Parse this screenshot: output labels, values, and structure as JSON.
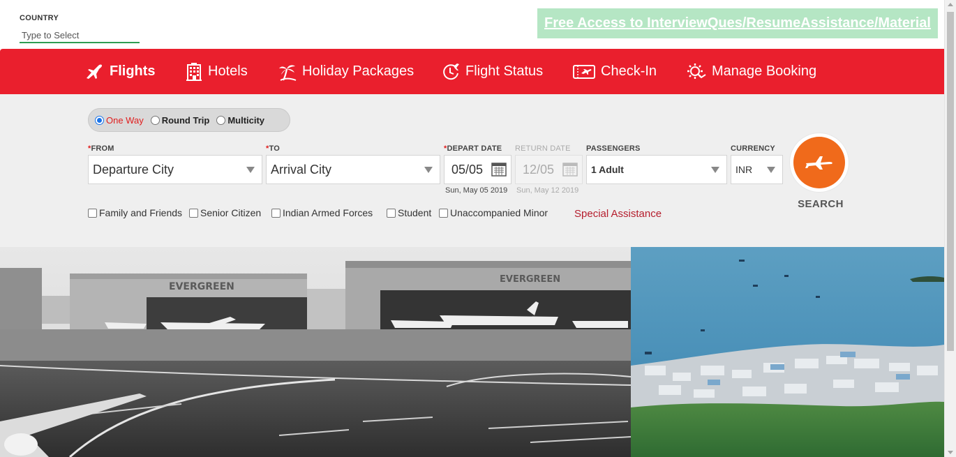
{
  "country": {
    "label": "COUNTRY",
    "placeholder": "Type to Select"
  },
  "promo": {
    "text": "Free Access to InterviewQues/ResumeAssistance/Material"
  },
  "nav": {
    "items": [
      {
        "label": "Flights",
        "icon": "airplane-icon",
        "active": true
      },
      {
        "label": "Hotels",
        "icon": "hotel-building-icon"
      },
      {
        "label": "Holiday Packages",
        "icon": "palm-tree-icon"
      },
      {
        "label": "Flight Status",
        "icon": "clock-plane-icon"
      },
      {
        "label": "Check-In",
        "icon": "ticket-icon"
      },
      {
        "label": "Manage Booking",
        "icon": "gear-booking-icon"
      }
    ]
  },
  "trip_type": {
    "options": [
      "One Way",
      "Round Trip",
      "Multicity"
    ],
    "selected": "One Way"
  },
  "form": {
    "from": {
      "label": "FROM",
      "value": "Departure City"
    },
    "to": {
      "label": "TO",
      "value": "Arrival City"
    },
    "depart": {
      "label": "DEPART DATE",
      "value": "05/05",
      "full": "Sun, May 05 2019"
    },
    "return": {
      "label": "RETURN DATE",
      "value": "12/05",
      "full": "Sun, May 12 2019"
    },
    "passengers": {
      "label": "PASSENGERS",
      "value": "1 Adult"
    },
    "currency": {
      "label": "CURRENCY",
      "value": "INR"
    }
  },
  "search": {
    "label": "SEARCH"
  },
  "concessions": [
    "Family and Friends",
    "Senior Citizen",
    "Indian Armed Forces",
    "Student",
    "Unaccompanied Minor"
  ],
  "special_assistance": "Special Assistance",
  "hero": {
    "left_sign": "EVERGREEN",
    "right_sign": "EVERGREEN"
  },
  "colors": {
    "nav": "#ea1f2d",
    "search": "#f06a1b",
    "promo": "#b5e6c4",
    "accent_red": "#e01d1d"
  }
}
